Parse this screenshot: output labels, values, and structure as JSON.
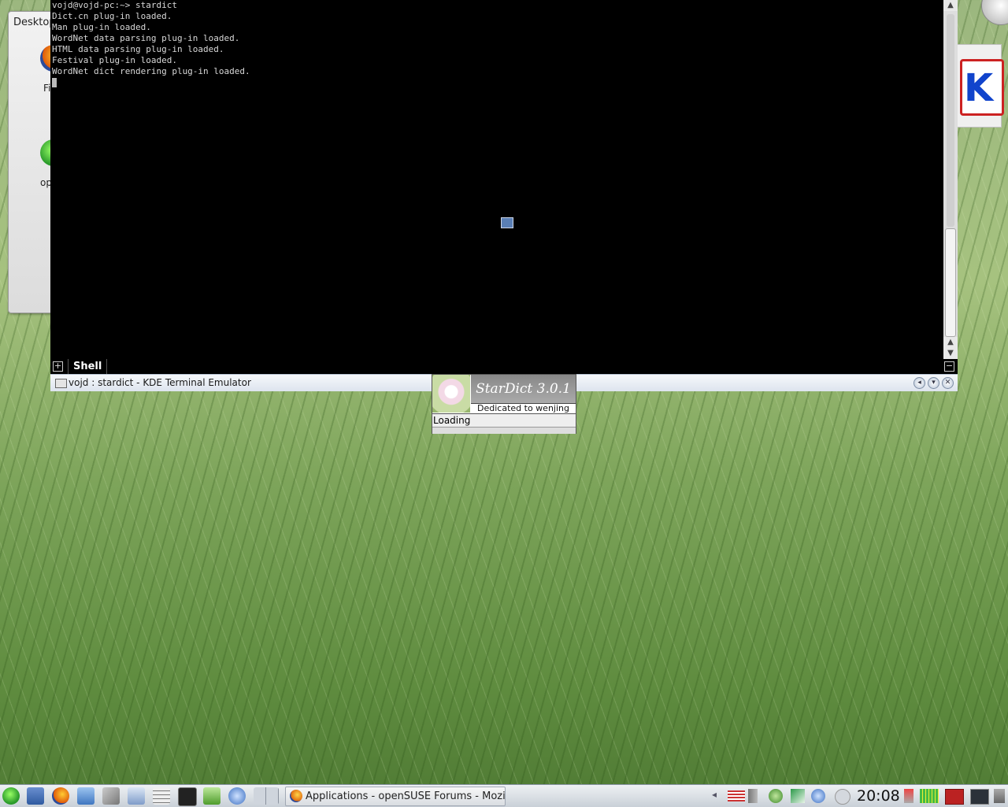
{
  "desktop": {
    "widget_title": "Desktop",
    "icons": [
      {
        "label": "Fi",
        "icon": "firefox-icon"
      },
      {
        "label": "oper",
        "icon": "opensuse-icon"
      }
    ],
    "right_widget_letter": "K"
  },
  "terminal": {
    "window_title": "vojd : stardict - KDE Terminal Emulator",
    "lines": [
      "vojd@vojd-pc:~> stardict",
      "Dict.cn plug-in loaded.",
      "Man plug-in loaded.",
      "WordNet data parsing plug-in loaded.",
      "HTML data parsing plug-in loaded.",
      "Festival plug-in loaded.",
      "WordNet dict rendering plug-in loaded."
    ],
    "tab_label": "Shell",
    "new_tab_symbol": "+",
    "close_tab_symbol": "−",
    "scroll_up": "▲",
    "scroll_down": "▼"
  },
  "splash": {
    "app_title": "StarDict 3.0.1",
    "dedication": "Dedicated to wenjing",
    "status": "Loading",
    "progress": 0
  },
  "taskbar": {
    "launchers": [
      "opensuse-menu-icon",
      "desktop-icon",
      "firefox-icon",
      "file-manager-icon",
      "tools-icon",
      "mail-icon",
      "calculator-icon",
      "terminal-icon",
      "home-icon",
      "browser-icon",
      "pager-icon"
    ],
    "task_title": "Applications - openSUSE Forums - Mozilla F",
    "clock": "20:08",
    "tray": [
      "us-flag-icon",
      "volume-icon",
      "update-icon",
      "network-icon",
      "konqueror-icon",
      "info-icon"
    ]
  },
  "colors": {
    "terminal_bg": "#000000",
    "terminal_fg": "#d8d8d8",
    "titlebar": "#e3e9f1"
  }
}
